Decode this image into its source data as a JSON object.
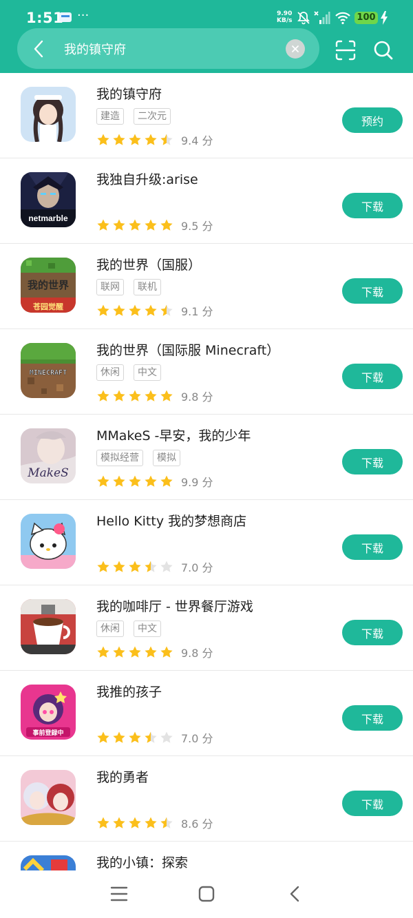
{
  "status_bar": {
    "time": "1:51",
    "more": "···",
    "net_speed_value": "9.90",
    "net_speed_unit": "KB/s",
    "battery": "100"
  },
  "search": {
    "query": "我的镇守府",
    "clear_label": "×"
  },
  "colors": {
    "accent": "#1fb89a",
    "star": "#fbbf1b",
    "star_empty": "#e3e3e3"
  },
  "results": [
    {
      "name": "我的镇守府",
      "tags": [
        "建造",
        "二次元"
      ],
      "stars": 4.5,
      "score": "9.4 分",
      "action": "预约"
    },
    {
      "name": "我独自升级:arise",
      "tags": [],
      "stars": 5,
      "score": "9.5 分",
      "action": "下载",
      "icon_text": "netmarble"
    },
    {
      "name": "我的世界（国服）",
      "tags": [
        "联网",
        "联机"
      ],
      "stars": 4.5,
      "score": "9.1 分",
      "action": "下载",
      "icon_text": "我的世界",
      "icon_subtext": "苍园觉醒"
    },
    {
      "name": "我的世界（国际服 Minecraft）",
      "tags": [
        "休闲",
        "中文"
      ],
      "stars": 5,
      "score": "9.8 分",
      "action": "下载",
      "icon_text": "MINECRAFT"
    },
    {
      "name": "MMakeS -早安，我的少年",
      "tags": [
        "模拟经营",
        "模拟"
      ],
      "stars": 5,
      "score": "9.9 分",
      "action": "下载",
      "icon_text": "MakeS"
    },
    {
      "name": "Hello Kitty 我的梦想商店",
      "tags": [],
      "stars": 3.5,
      "score": "7.0 分",
      "action": "下载"
    },
    {
      "name": "我的咖啡厅 - 世界餐厅游戏",
      "tags": [
        "休闲",
        "中文"
      ],
      "stars": 5,
      "score": "9.8 分",
      "action": "下载"
    },
    {
      "name": "我推的孩子",
      "tags": [],
      "stars": 3.5,
      "score": "7.0 分",
      "action": "下载",
      "icon_text": "事前登録中"
    },
    {
      "name": "我的勇者",
      "tags": [],
      "stars": 4.5,
      "score": "8.6 分",
      "action": "下载"
    },
    {
      "name": "我的小镇：探索",
      "tags": [],
      "stars": 0,
      "score": "",
      "action": ""
    }
  ]
}
